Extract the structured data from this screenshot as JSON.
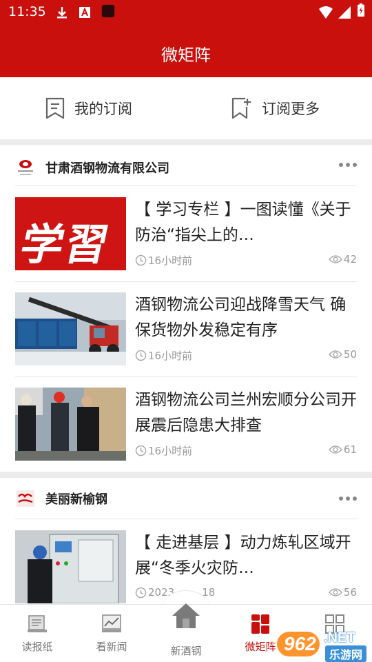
{
  "status": {
    "time": "11:35"
  },
  "app": {
    "title": "微矩阵"
  },
  "subscribe": {
    "mine_label": "我的订阅",
    "more_label": "订阅更多"
  },
  "cards": [
    {
      "name": "甘肃酒钢物流有限公司",
      "articles": [
        {
          "title": "【 学习专栏 】一图读懂《关于防治“指尖上的…",
          "time": "16小时前",
          "views": "42",
          "thumb_text": "学習"
        },
        {
          "title": "酒钢物流公司迎战降雪天气 确保货物外发稳定有序",
          "time": "16小时前",
          "views": "50"
        },
        {
          "title": "酒钢物流公司兰州宏顺分公司开展震后隐患大排查",
          "time": "16小时前",
          "views": "61"
        }
      ]
    },
    {
      "name": "美丽新榆钢",
      "articles": [
        {
          "title": "【 走进基层 】动力炼轧区域开展“冬季火灾防…",
          "time": "2023",
          "time_suffix": "18",
          "views": "56"
        }
      ]
    }
  ],
  "tabs": [
    {
      "label": "读报纸",
      "icon": "newspaper-icon"
    },
    {
      "label": "看新闻",
      "icon": "news-chart-icon"
    },
    {
      "label": "新酒钢",
      "icon": "home-icon"
    },
    {
      "label": "微矩阵",
      "icon": "matrix-icon",
      "active": true
    },
    {
      "label": "",
      "icon": "qr-grid-icon"
    }
  ],
  "watermark": {
    "brand": "962",
    "suffix": ".NET",
    "sub": "乐游网"
  },
  "colors": {
    "brand_red": "#c9100c"
  }
}
